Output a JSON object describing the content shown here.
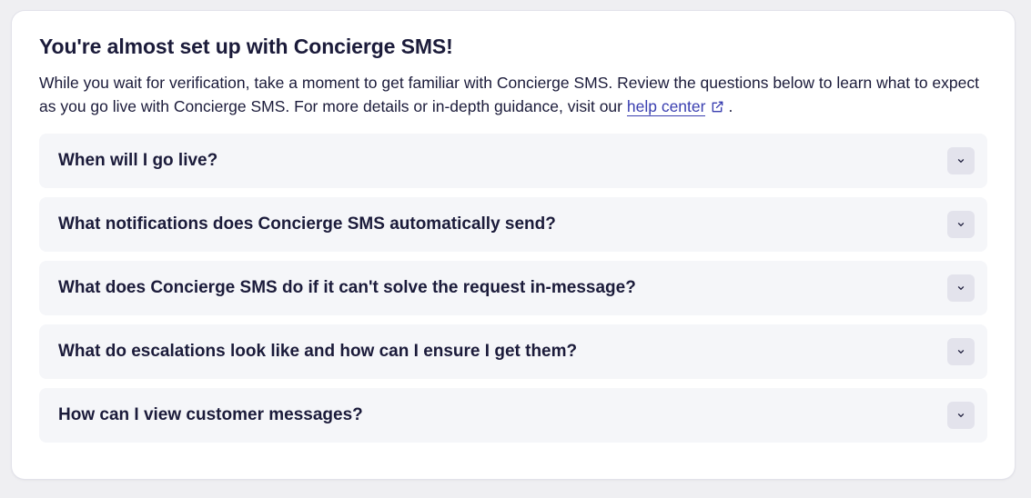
{
  "setup": {
    "title": "You're almost set up with Concierge SMS!",
    "intro_text": "While you wait for verification, take a moment to get familiar with Concierge SMS. Review the questions below to learn what to expect as you go live with Concierge SMS. For more details or in-depth guidance, visit our",
    "link_label": "help center",
    "link_icon": "external-link-icon",
    "intro_end": "."
  },
  "faq": {
    "chevron_icon": "chevron-down-icon",
    "items": [
      {
        "question": "When will I go live?"
      },
      {
        "question": "What notifications does Concierge SMS automatically send?"
      },
      {
        "question": "What does Concierge SMS do if it can't solve the request in-message?"
      },
      {
        "question": "What do escalations look like and how can I ensure I get them?"
      },
      {
        "question": "How can I view customer messages?"
      }
    ]
  },
  "colors": {
    "text": "#1b1b3a",
    "link": "#3a3fb0",
    "item_background": "#f5f6f9",
    "chevron_button": "#e3e3ec",
    "page_background": "#efeff2"
  }
}
